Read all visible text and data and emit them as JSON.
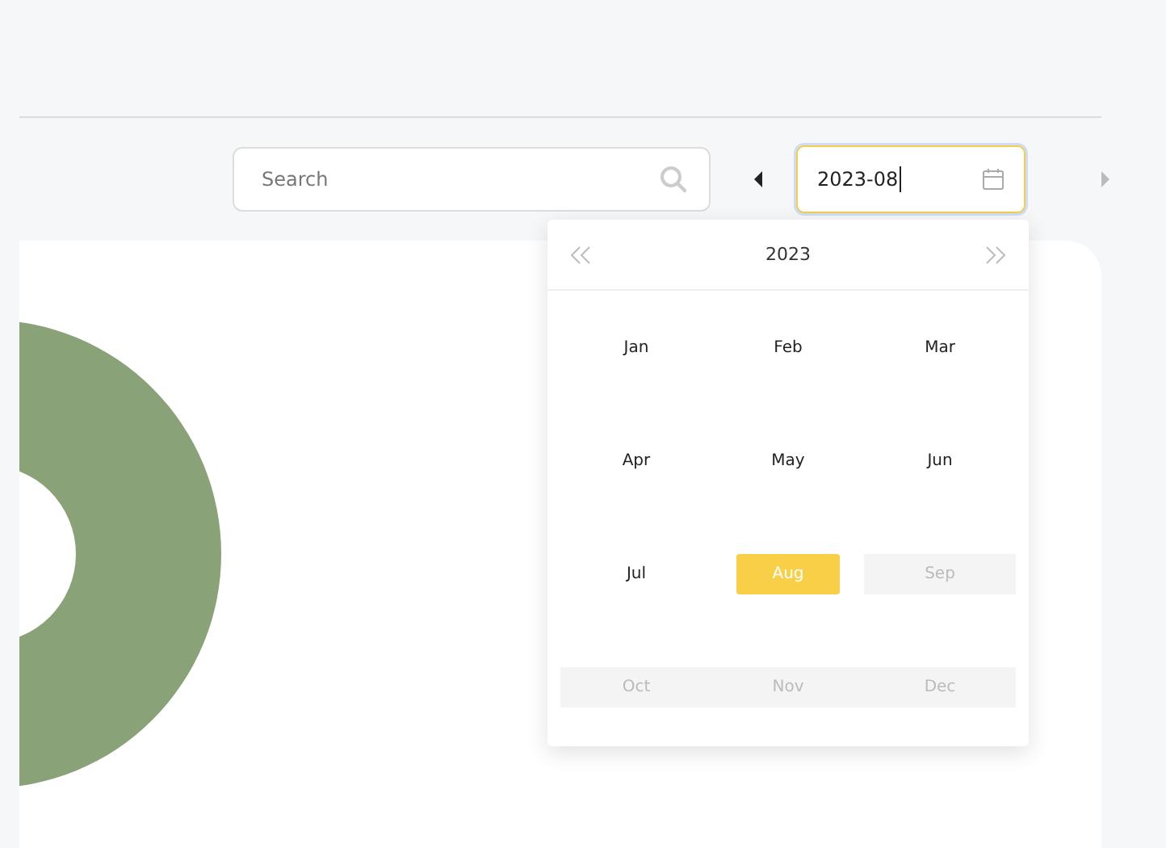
{
  "toolbar": {
    "search": {
      "placeholder": "Search"
    },
    "prev_month": {
      "disabled": false
    },
    "date_field": {
      "value": "2023-08",
      "focused": true
    },
    "next_month": {
      "disabled": true
    }
  },
  "month_picker": {
    "year": "2023",
    "prev_year": {
      "disabled": false
    },
    "next_year": {
      "disabled": false
    },
    "months": [
      {
        "label": "Jan",
        "selected": false,
        "disabled": false
      },
      {
        "label": "Feb",
        "selected": false,
        "disabled": false
      },
      {
        "label": "Mar",
        "selected": false,
        "disabled": false
      },
      {
        "label": "Apr",
        "selected": false,
        "disabled": false
      },
      {
        "label": "May",
        "selected": false,
        "disabled": false
      },
      {
        "label": "Jun",
        "selected": false,
        "disabled": false
      },
      {
        "label": "Jul",
        "selected": false,
        "disabled": false
      },
      {
        "label": "Aug",
        "selected": true,
        "disabled": false
      },
      {
        "label": "Sep",
        "selected": false,
        "disabled": true
      },
      {
        "label": "Oct",
        "selected": false,
        "disabled": true
      },
      {
        "label": "Nov",
        "selected": false,
        "disabled": true
      },
      {
        "label": "Dec",
        "selected": false,
        "disabled": true
      }
    ]
  }
}
